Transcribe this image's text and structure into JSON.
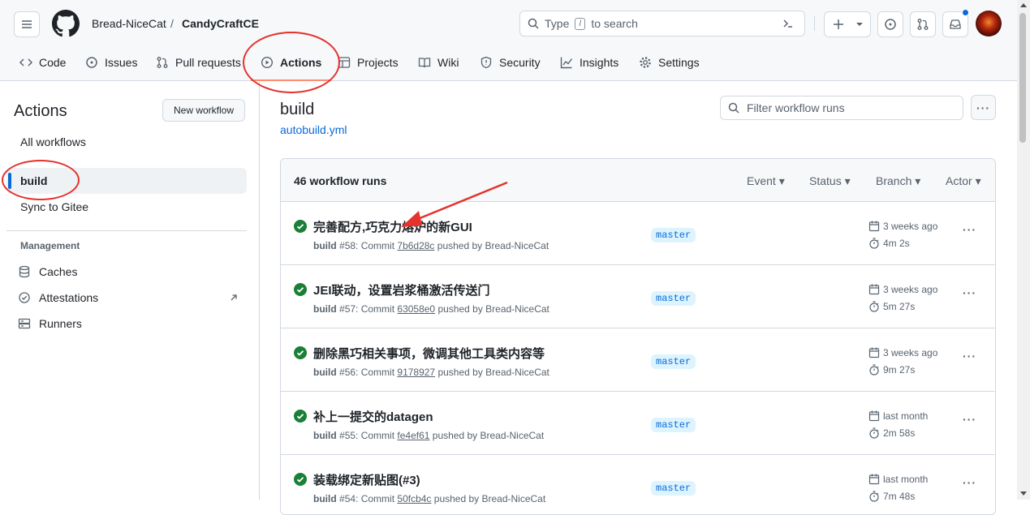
{
  "header": {
    "owner": "Bread-NiceCat",
    "separator": "/",
    "repo": "CandyCraftCE",
    "search_pre": "Type",
    "search_key": "/",
    "search_post": "to search"
  },
  "nav": [
    {
      "label": "Code"
    },
    {
      "label": "Issues"
    },
    {
      "label": "Pull requests"
    },
    {
      "label": "Actions"
    },
    {
      "label": "Projects"
    },
    {
      "label": "Wiki"
    },
    {
      "label": "Security"
    },
    {
      "label": "Insights"
    },
    {
      "label": "Settings"
    }
  ],
  "sidebar": {
    "title": "Actions",
    "new_workflow": "New workflow",
    "all_workflows": "All workflows",
    "build": "build",
    "sync": "Sync to Gitee",
    "management": "Management",
    "caches": "Caches",
    "attestations": "Attestations",
    "runners": "Runners"
  },
  "main": {
    "title": "build",
    "file": "autobuild.yml",
    "filter_placeholder": "Filter workflow runs",
    "count": "46 workflow runs",
    "filters": [
      "Event",
      "Status",
      "Branch",
      "Actor"
    ]
  },
  "runs": [
    {
      "title": "完善配方,巧克力熔炉的新GUI",
      "workflow": "build",
      "num": "#58: Commit",
      "sha": "7b6d28c",
      "by": "pushed by Bread-NiceCat",
      "branch": "master",
      "when": "3 weeks ago",
      "duration": "4m 2s"
    },
    {
      "title": "JEI联动，设置岩浆桶激活传送门",
      "workflow": "build",
      "num": "#57: Commit",
      "sha": "63058e0",
      "by": "pushed by Bread-NiceCat",
      "branch": "master",
      "when": "3 weeks ago",
      "duration": "5m 27s"
    },
    {
      "title": "删除黑巧相关事项，微调其他工具类内容等",
      "workflow": "build",
      "num": "#56: Commit",
      "sha": "9178927",
      "by": "pushed by Bread-NiceCat",
      "branch": "master",
      "when": "3 weeks ago",
      "duration": "9m 27s"
    },
    {
      "title": "补上一提交的datagen",
      "workflow": "build",
      "num": "#55: Commit",
      "sha": "fe4ef61",
      "by": "pushed by Bread-NiceCat",
      "branch": "master",
      "when": "last month",
      "duration": "2m 58s"
    },
    {
      "title": "装载绑定新贴图(#3)",
      "workflow": "build",
      "num": "#54: Commit",
      "sha": "50fcb4c",
      "by": "pushed by Bread-NiceCat",
      "branch": "master",
      "when": "last month",
      "duration": "7m 48s"
    }
  ],
  "colors": {
    "accent": "#0969da",
    "success": "#1a7f37",
    "annotation": "#e5322d",
    "underline": "#fd8c73"
  }
}
